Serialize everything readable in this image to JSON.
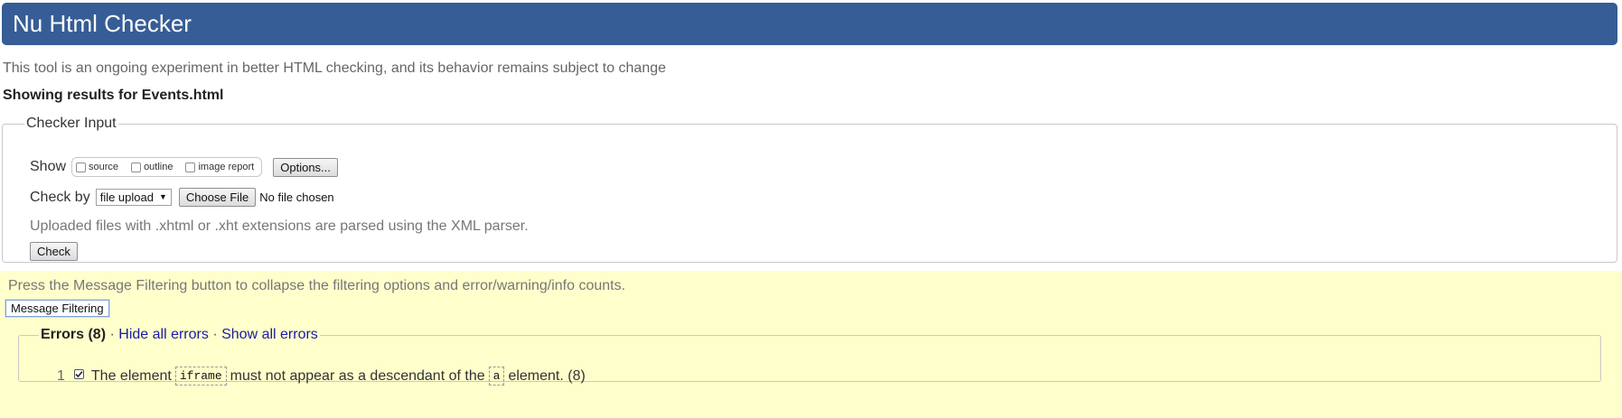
{
  "header": {
    "title": "Nu Html Checker",
    "bg_color": "#365d95"
  },
  "intro": "This tool is an ongoing experiment in better HTML checking, and its behavior remains subject to change",
  "showing": "Showing results for Events.html",
  "checker_input": {
    "legend": "Checker Input",
    "show_label": "Show",
    "show_options": [
      "source",
      "outline",
      "image report"
    ],
    "options_button": "Options...",
    "check_by_label": "Check by",
    "check_by_selected": "file upload",
    "choose_file_button": "Choose File",
    "no_file_text": "No file chosen",
    "note": "Uploaded files with .xhtml or .xht extensions are parsed using the XML parser.",
    "check_button": "Check"
  },
  "filtering": {
    "bg_color": "#ffffcc",
    "note": "Press the Message Filtering button to collapse the filtering options and error/warning/info counts.",
    "button": "Message Filtering",
    "errors": {
      "title": "Errors (8)",
      "separator": "·",
      "hide_all": "Hide all errors",
      "show_all": "Show all errors",
      "items": [
        {
          "number": "1",
          "text_before": "The element",
          "code1": "iframe",
          "text_middle": "must not appear as a descendant of the",
          "code2": "a",
          "text_after": "element. (8)",
          "checked": true
        }
      ]
    }
  }
}
